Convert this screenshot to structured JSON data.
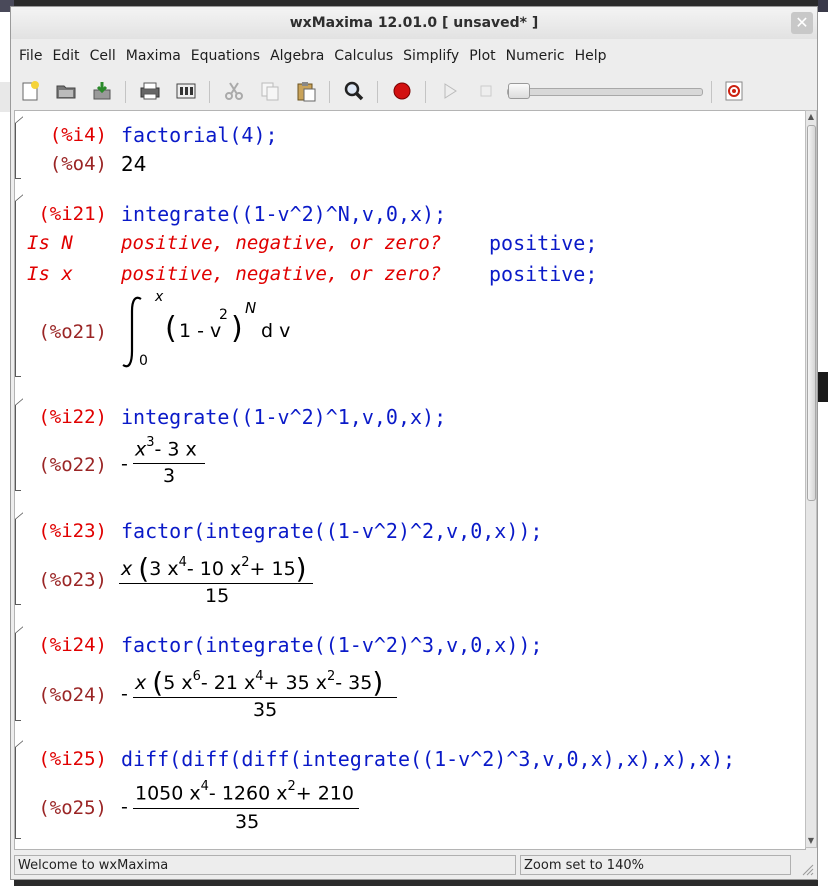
{
  "window": {
    "title": "wxMaxima 12.01.0 [ unsaved* ]",
    "close_glyph": "✕"
  },
  "menu": [
    "File",
    "Edit",
    "Cell",
    "Maxima",
    "Equations",
    "Algebra",
    "Calculus",
    "Simplify",
    "Plot",
    "Numeric",
    "Help"
  ],
  "toolbar": {
    "icons": [
      "new-file-icon",
      "open-folder-icon",
      "save-icon",
      "print-icon",
      "configure-icon",
      "cut-icon",
      "copy-icon",
      "paste-icon",
      "search-icon",
      "record-icon",
      "play-icon",
      "stop-icon",
      "animation-slider",
      "interrupt-icon"
    ]
  },
  "cells": [
    {
      "in_label": "(%i4)",
      "input": "factorial(4);",
      "out_label": "(%o4)",
      "output": "24"
    },
    {
      "in_label": "(%i21)",
      "input": "integrate((1-v^2)^N,v,0,x);",
      "questions": [
        {
          "var": "Is  N",
          "text": "positive, negative, or zero?",
          "answer": "positive;"
        },
        {
          "var": "Is  x",
          "text": "positive, negative, or zero?",
          "answer": "positive;"
        }
      ],
      "out_label": "(%o21)",
      "output_parts": {
        "upper": "x",
        "lower": "0",
        "base": "1 - v",
        "inner_exp": "2",
        "outer_exp": "N",
        "diff": "d v"
      }
    },
    {
      "in_label": "(%i22)",
      "input": "integrate((1-v^2)^1,v,0,x);",
      "out_label": "(%o22)",
      "output_parts": {
        "sign": "-",
        "num_a": "x",
        "num_a_exp": "3",
        "num_b": "- 3 x",
        "den": "3"
      }
    },
    {
      "in_label": "(%i23)",
      "input": "factor(integrate((1-v^2)^2,v,0,x));",
      "out_label": "(%o23)",
      "output_parts": {
        "lead": "x",
        "c1": "3 x",
        "e1": "4",
        "c2": "- 10 x",
        "e2": "2",
        "c3": "+ 15",
        "den": "15"
      }
    },
    {
      "in_label": "(%i24)",
      "input": "factor(integrate((1-v^2)^3,v,0,x));",
      "out_label": "(%o24)",
      "output_parts": {
        "sign": "-",
        "lead": "x",
        "c1": "5 x",
        "e1": "6",
        "c2": "- 21 x",
        "e2": "4",
        "c3": "+ 35 x",
        "e3": "2",
        "c4": "- 35",
        "den": "35"
      }
    },
    {
      "in_label": "(%i25)",
      "input": "diff(diff(diff(integrate((1-v^2)^3,v,0,x),x),x),x);",
      "out_label": "(%o25)",
      "output_parts": {
        "sign": "-",
        "c1": "1050 x",
        "e1": "4",
        "c2": "- 1260 x",
        "e2": "2",
        "c3": "+ 210",
        "den": "35"
      }
    }
  ],
  "status": {
    "left": "Welcome to wxMaxima",
    "right": "Zoom set to 140%"
  },
  "colors": {
    "input_label": "#e00000",
    "output_label": "#9a2525",
    "code": "#0a1ac8"
  }
}
